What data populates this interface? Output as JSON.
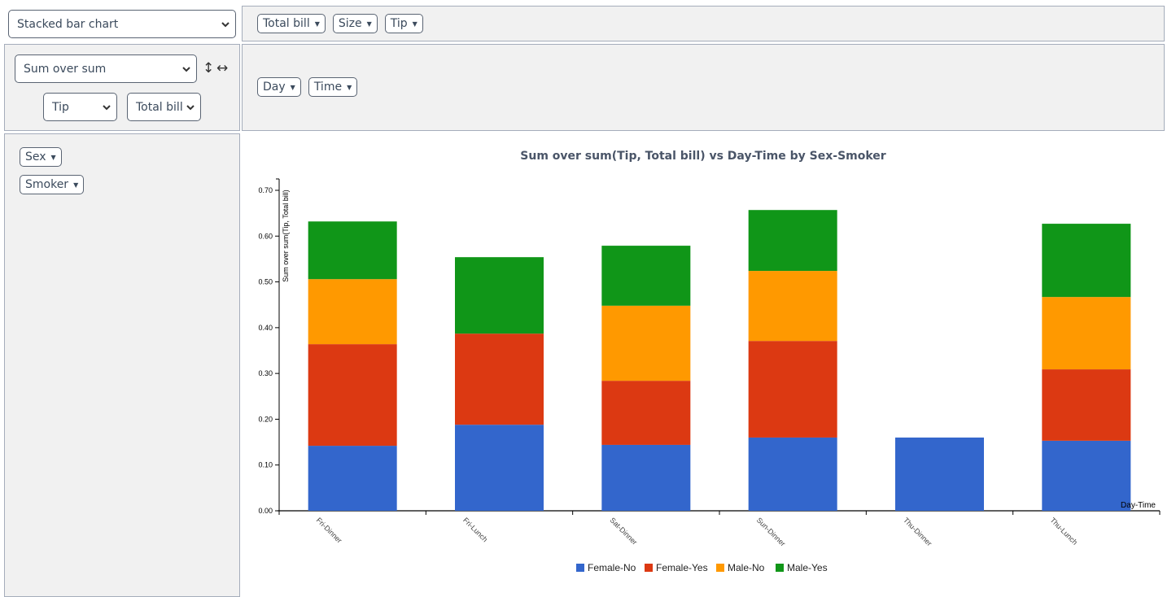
{
  "controls": {
    "chart_type": "Stacked bar chart",
    "aggregator": "Sum over sum",
    "sort_vertical_icon": "up-down-arrow-icon",
    "sort_horizontal_icon": "left-right-arrow-icon",
    "agg_arg1": "Tip",
    "agg_arg2": "Total bill"
  },
  "unused_fields": [
    {
      "label": "Total bill"
    },
    {
      "label": "Size"
    },
    {
      "label": "Tip"
    }
  ],
  "column_fields": [
    {
      "label": "Day"
    },
    {
      "label": "Time"
    }
  ],
  "row_fields": [
    {
      "label": "Sex"
    },
    {
      "label": "Smoker"
    }
  ],
  "dropdown_marker": "▼",
  "chart_data": {
    "type": "bar",
    "stacked": true,
    "title": "Sum over sum(Tip, Total bill) vs Day-Time by Sex-Smoker",
    "xlabel": "Day-Time",
    "ylabel": "Sum over sum(Tip, Total bill)",
    "ylim": [
      0,
      0.72
    ],
    "yticks": [
      "0.00",
      "0.10",
      "0.20",
      "0.30",
      "0.40",
      "0.50",
      "0.60",
      "0.70"
    ],
    "ytick_values": [
      0,
      0.1,
      0.2,
      0.3,
      0.4,
      0.5,
      0.6,
      0.7
    ],
    "categories": [
      "Fri-Dinner",
      "Fri-Lunch",
      "Sat-Dinner",
      "Sun-Dinner",
      "Thu-Dinner",
      "Thu-Lunch"
    ],
    "series": [
      {
        "name": "Female-No",
        "color": "#3366cc",
        "values": [
          0.142,
          0.188,
          0.144,
          0.16,
          0.16,
          0.153
        ]
      },
      {
        "name": "Female-Yes",
        "color": "#dc3912",
        "values": [
          0.222,
          0.199,
          0.14,
          0.211,
          0,
          0.156
        ]
      },
      {
        "name": "Male-No",
        "color": "#ff9900",
        "values": [
          0.142,
          0,
          0.164,
          0.153,
          0,
          0.158
        ]
      },
      {
        "name": "Male-Yes",
        "color": "#109618",
        "values": [
          0.126,
          0.167,
          0.131,
          0.133,
          0,
          0.16
        ]
      }
    ],
    "legend_position": "bottom",
    "grid": false
  }
}
